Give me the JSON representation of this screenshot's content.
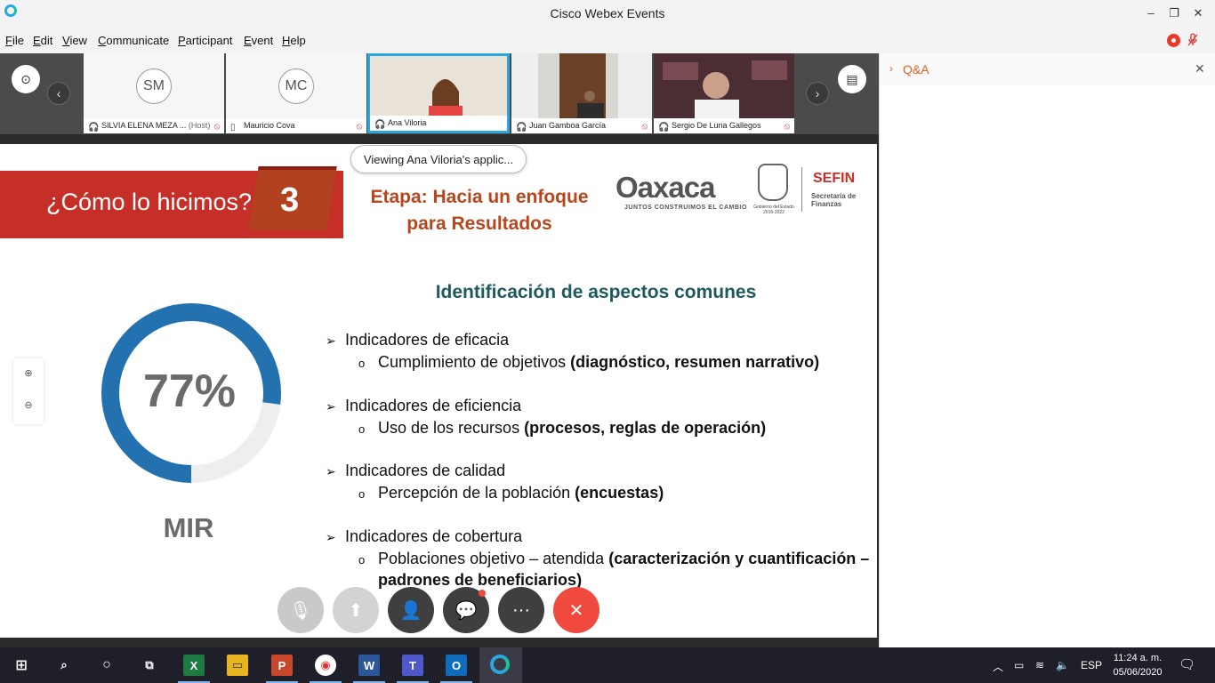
{
  "window": {
    "title": "Cisco Webex Events",
    "controls": {
      "minimize": "–",
      "restore": "❐",
      "close": "✕"
    }
  },
  "menu": [
    {
      "accel": "F",
      "rest": "ile"
    },
    {
      "accel": "E",
      "rest": "dit"
    },
    {
      "accel": "V",
      "rest": "iew"
    },
    {
      "accel": "C",
      "rest": "ommunicate"
    },
    {
      "accel": "P",
      "rest": "articipant"
    },
    {
      "accel": "E",
      "rest": "vent"
    },
    {
      "accel": "H",
      "rest": "elp"
    }
  ],
  "participants": [
    {
      "initials": "SM",
      "name": "SILVIA ELENA MEZA ...",
      "role": "(Host)",
      "muted": true
    },
    {
      "initials": "MC",
      "name": "Mauricio Cova",
      "role": "",
      "muted": true
    },
    {
      "initials": "",
      "name": "Ana Viloria",
      "role": "",
      "muted": false,
      "active": true
    },
    {
      "initials": "",
      "name": "Juan Gamboa García",
      "role": "",
      "muted": true
    },
    {
      "initials": "",
      "name": "Sergio De Luna Gallegos",
      "role": "",
      "muted": true
    }
  ],
  "viewing_label": "Viewing Ana Viloria's applic...",
  "slide": {
    "banner_title": "¿Cómo lo hicimos?",
    "banner_number": "3",
    "etapa_line1": "Etapa: Hacia un enfoque",
    "etapa_line2": "para Resultados",
    "logo_oaxaca": "Oaxaca",
    "logo_oaxaca_tagline": "JUNTOS CONSTRUIMOS EL CAMBIO",
    "seal_caption": "Gobierno del Estado 2016-2022",
    "logo_sefin": "SEFIN",
    "logo_sefin_sub1": "Secretaría de",
    "logo_sefin_sub2": "Finanzas",
    "percent_text": "77%",
    "percent_value": 0.77,
    "mir_label": "MIR",
    "heading": "Identificación de aspectos comunes",
    "bullets": [
      {
        "head": "Indicadores de eficacia",
        "sub_plain": "Cumplimiento de objetivos ",
        "sub_bold": "(diagnóstico, resumen narrativo)",
        "sub_bold2": ""
      },
      {
        "head": "Indicadores de eficiencia",
        "sub_plain": "Uso de los recursos ",
        "sub_bold": "(procesos, reglas de operación)",
        "sub_bold2": ""
      },
      {
        "head": "Indicadores de calidad",
        "sub_plain": "Percepción de la población ",
        "sub_bold": "(encuestas)",
        "sub_bold2": ""
      },
      {
        "head": "Indicadores de cobertura",
        "sub_plain": "Poblaciones objetivo – atendida ",
        "sub_bold": "(caracterización y cuantificación –",
        "sub_bold2": "padrones de beneficiarios)"
      }
    ],
    "colors": {
      "donut": "#2471b0",
      "donut_track": "#eeeeee",
      "banner": "#c62f27",
      "etapa": "#b8461c",
      "heading": "#1d5a5e"
    }
  },
  "callbar": [
    {
      "name": "mute-button",
      "icon": "mic-off-icon",
      "glyph": "🎙",
      "color": "#c9c9c9"
    },
    {
      "name": "share-button",
      "icon": "share-icon",
      "glyph": "⬆",
      "color": "#d3d3d3"
    },
    {
      "name": "participants-button",
      "icon": "participants-icon",
      "glyph": "👤",
      "color": "#3f3f3f"
    },
    {
      "name": "chat-button",
      "icon": "chat-icon",
      "glyph": "💬",
      "color": "#3f3f3f"
    },
    {
      "name": "more-button",
      "icon": "more-icon",
      "glyph": "···",
      "color": "#3f3f3f"
    },
    {
      "name": "leave-button",
      "icon": "close-icon",
      "glyph": "✕",
      "color": "#f0493e"
    }
  ],
  "qa": {
    "title": "Q&A",
    "chevron": "›",
    "close": "✕"
  },
  "taskbar": {
    "lang": "ESP",
    "time": "11:24 a. m.",
    "date": "05/06/2020"
  }
}
